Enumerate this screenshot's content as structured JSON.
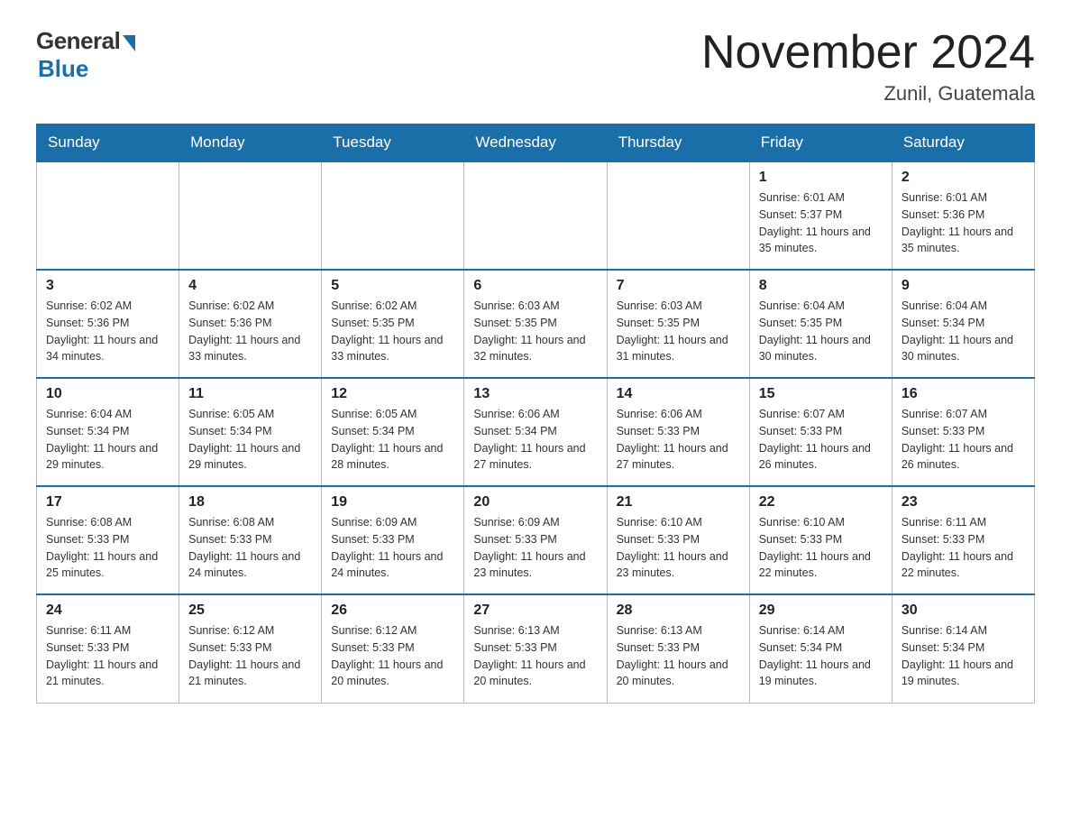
{
  "header": {
    "logo_general": "General",
    "logo_blue": "Blue",
    "month_title": "November 2024",
    "location": "Zunil, Guatemala"
  },
  "calendar": {
    "days_of_week": [
      "Sunday",
      "Monday",
      "Tuesday",
      "Wednesday",
      "Thursday",
      "Friday",
      "Saturday"
    ],
    "weeks": [
      [
        {
          "day": "",
          "info": ""
        },
        {
          "day": "",
          "info": ""
        },
        {
          "day": "",
          "info": ""
        },
        {
          "day": "",
          "info": ""
        },
        {
          "day": "",
          "info": ""
        },
        {
          "day": "1",
          "info": "Sunrise: 6:01 AM\nSunset: 5:37 PM\nDaylight: 11 hours and 35 minutes."
        },
        {
          "day": "2",
          "info": "Sunrise: 6:01 AM\nSunset: 5:36 PM\nDaylight: 11 hours and 35 minutes."
        }
      ],
      [
        {
          "day": "3",
          "info": "Sunrise: 6:02 AM\nSunset: 5:36 PM\nDaylight: 11 hours and 34 minutes."
        },
        {
          "day": "4",
          "info": "Sunrise: 6:02 AM\nSunset: 5:36 PM\nDaylight: 11 hours and 33 minutes."
        },
        {
          "day": "5",
          "info": "Sunrise: 6:02 AM\nSunset: 5:35 PM\nDaylight: 11 hours and 33 minutes."
        },
        {
          "day": "6",
          "info": "Sunrise: 6:03 AM\nSunset: 5:35 PM\nDaylight: 11 hours and 32 minutes."
        },
        {
          "day": "7",
          "info": "Sunrise: 6:03 AM\nSunset: 5:35 PM\nDaylight: 11 hours and 31 minutes."
        },
        {
          "day": "8",
          "info": "Sunrise: 6:04 AM\nSunset: 5:35 PM\nDaylight: 11 hours and 30 minutes."
        },
        {
          "day": "9",
          "info": "Sunrise: 6:04 AM\nSunset: 5:34 PM\nDaylight: 11 hours and 30 minutes."
        }
      ],
      [
        {
          "day": "10",
          "info": "Sunrise: 6:04 AM\nSunset: 5:34 PM\nDaylight: 11 hours and 29 minutes."
        },
        {
          "day": "11",
          "info": "Sunrise: 6:05 AM\nSunset: 5:34 PM\nDaylight: 11 hours and 29 minutes."
        },
        {
          "day": "12",
          "info": "Sunrise: 6:05 AM\nSunset: 5:34 PM\nDaylight: 11 hours and 28 minutes."
        },
        {
          "day": "13",
          "info": "Sunrise: 6:06 AM\nSunset: 5:34 PM\nDaylight: 11 hours and 27 minutes."
        },
        {
          "day": "14",
          "info": "Sunrise: 6:06 AM\nSunset: 5:33 PM\nDaylight: 11 hours and 27 minutes."
        },
        {
          "day": "15",
          "info": "Sunrise: 6:07 AM\nSunset: 5:33 PM\nDaylight: 11 hours and 26 minutes."
        },
        {
          "day": "16",
          "info": "Sunrise: 6:07 AM\nSunset: 5:33 PM\nDaylight: 11 hours and 26 minutes."
        }
      ],
      [
        {
          "day": "17",
          "info": "Sunrise: 6:08 AM\nSunset: 5:33 PM\nDaylight: 11 hours and 25 minutes."
        },
        {
          "day": "18",
          "info": "Sunrise: 6:08 AM\nSunset: 5:33 PM\nDaylight: 11 hours and 24 minutes."
        },
        {
          "day": "19",
          "info": "Sunrise: 6:09 AM\nSunset: 5:33 PM\nDaylight: 11 hours and 24 minutes."
        },
        {
          "day": "20",
          "info": "Sunrise: 6:09 AM\nSunset: 5:33 PM\nDaylight: 11 hours and 23 minutes."
        },
        {
          "day": "21",
          "info": "Sunrise: 6:10 AM\nSunset: 5:33 PM\nDaylight: 11 hours and 23 minutes."
        },
        {
          "day": "22",
          "info": "Sunrise: 6:10 AM\nSunset: 5:33 PM\nDaylight: 11 hours and 22 minutes."
        },
        {
          "day": "23",
          "info": "Sunrise: 6:11 AM\nSunset: 5:33 PM\nDaylight: 11 hours and 22 minutes."
        }
      ],
      [
        {
          "day": "24",
          "info": "Sunrise: 6:11 AM\nSunset: 5:33 PM\nDaylight: 11 hours and 21 minutes."
        },
        {
          "day": "25",
          "info": "Sunrise: 6:12 AM\nSunset: 5:33 PM\nDaylight: 11 hours and 21 minutes."
        },
        {
          "day": "26",
          "info": "Sunrise: 6:12 AM\nSunset: 5:33 PM\nDaylight: 11 hours and 20 minutes."
        },
        {
          "day": "27",
          "info": "Sunrise: 6:13 AM\nSunset: 5:33 PM\nDaylight: 11 hours and 20 minutes."
        },
        {
          "day": "28",
          "info": "Sunrise: 6:13 AM\nSunset: 5:33 PM\nDaylight: 11 hours and 20 minutes."
        },
        {
          "day": "29",
          "info": "Sunrise: 6:14 AM\nSunset: 5:34 PM\nDaylight: 11 hours and 19 minutes."
        },
        {
          "day": "30",
          "info": "Sunrise: 6:14 AM\nSunset: 5:34 PM\nDaylight: 11 hours and 19 minutes."
        }
      ]
    ]
  }
}
